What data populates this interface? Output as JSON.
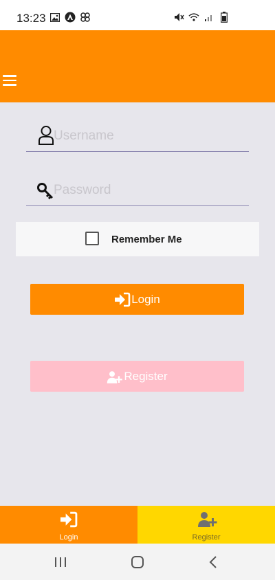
{
  "status_bar": {
    "time": "13:23",
    "left_icons": [
      "image-icon",
      "app-a-icon",
      "pinwheel-icon"
    ],
    "right_icons": [
      "mute-icon",
      "wifi-icon",
      "signal-icon",
      "battery-icon"
    ]
  },
  "app_bar": {
    "color": "#ff8b00",
    "menu_icon": "hamburger-menu-icon"
  },
  "form": {
    "username": {
      "placeholder": "Username",
      "value": "",
      "icon": "user-icon"
    },
    "password": {
      "placeholder": "Password",
      "value": "",
      "icon": "key-icon"
    },
    "remember_me": {
      "label": "Remember Me",
      "checked": false
    }
  },
  "buttons": {
    "login": {
      "label": "Login",
      "icon": "sign-in-icon",
      "color": "#ff8b00"
    },
    "register": {
      "label": "Register",
      "icon": "user-plus-icon",
      "color": "#ffbfca"
    }
  },
  "bottom_nav": {
    "tabs": [
      {
        "label": "Login",
        "icon": "sign-in-icon",
        "color": "#ff8b00",
        "active": true
      },
      {
        "label": "Register",
        "icon": "user-plus-icon",
        "color": "#ffd700",
        "active": false
      }
    ]
  },
  "system_nav": [
    "recents-icon",
    "home-icon",
    "back-icon"
  ]
}
